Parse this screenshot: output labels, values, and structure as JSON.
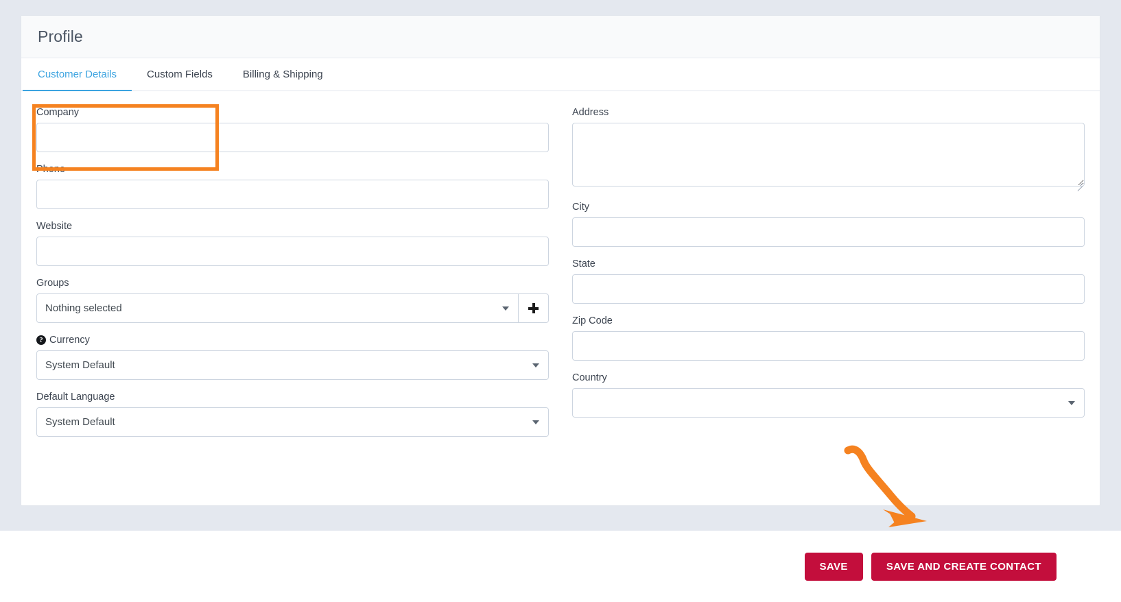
{
  "card": {
    "title": "Profile"
  },
  "tabs": [
    {
      "label": "Customer Details",
      "active": true
    },
    {
      "label": "Custom Fields",
      "active": false
    },
    {
      "label": "Billing & Shipping",
      "active": false
    }
  ],
  "left_column": {
    "company": {
      "label": "Company",
      "value": "",
      "placeholder": ""
    },
    "phone": {
      "label": "Phone",
      "value": "",
      "placeholder": ""
    },
    "website": {
      "label": "Website",
      "value": "",
      "placeholder": ""
    },
    "groups": {
      "label": "Groups",
      "value": "Nothing selected",
      "add_button": "+"
    },
    "currency": {
      "label": "Currency",
      "value": "System Default",
      "help_icon": "question-mark-circle-icon",
      "help_glyph": "?"
    },
    "default_language": {
      "label": "Default Language",
      "value": "System Default"
    }
  },
  "right_column": {
    "address": {
      "label": "Address",
      "value": "",
      "placeholder": ""
    },
    "city": {
      "label": "City",
      "value": "",
      "placeholder": ""
    },
    "state": {
      "label": "State",
      "value": "",
      "placeholder": ""
    },
    "zip_code": {
      "label": "Zip Code",
      "value": "",
      "placeholder": ""
    },
    "country": {
      "label": "Country",
      "value": ""
    }
  },
  "footer": {
    "save_label": "SAVE",
    "save_create_contact_label": "SAVE AND CREATE CONTACT"
  },
  "annotations": {
    "highlight_color": "#f58220",
    "arrow_color": "#f58220",
    "highlight_target": "company-field",
    "arrow_target": "save-and-create-contact-button"
  },
  "colors": {
    "accent_tab": "#3ba3e0",
    "button_primary": "#c30e3c",
    "page_background": "#e4e8ef",
    "card_background": "#ffffff",
    "border": "#cdd5e0"
  }
}
